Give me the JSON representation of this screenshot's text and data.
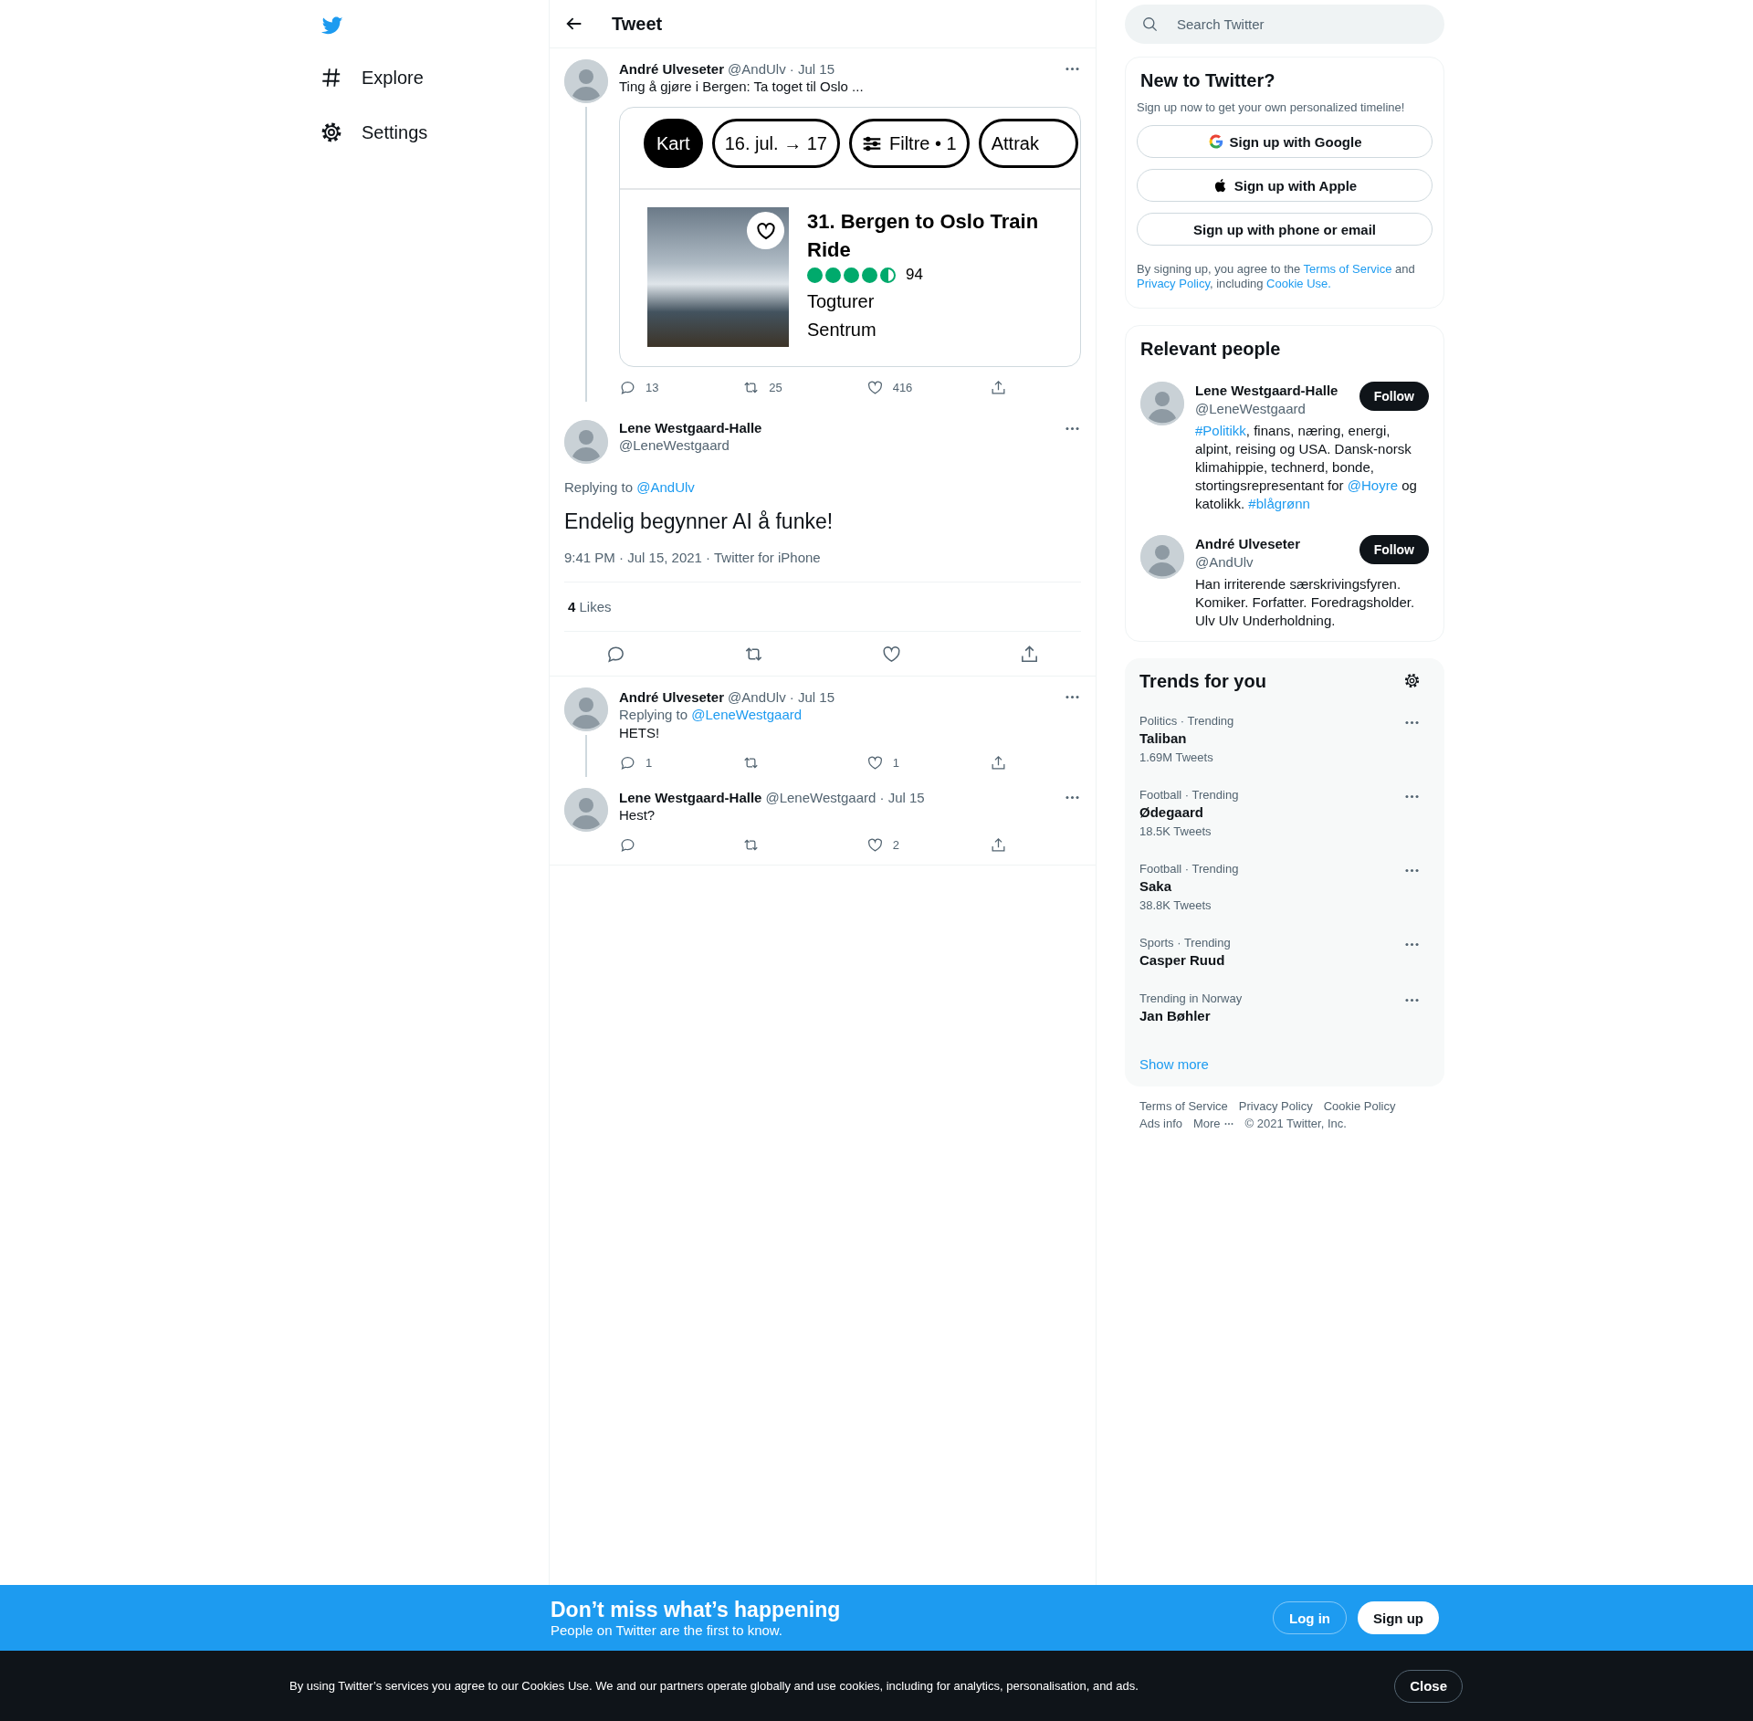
{
  "nav": {
    "items": [
      {
        "kind": "explore",
        "label": "Explore"
      },
      {
        "kind": "settings",
        "label": "Settings"
      }
    ]
  },
  "header": {
    "title": "Tweet"
  },
  "tweets": [
    {
      "kind": "thread",
      "name": "André Ulveseter",
      "meta": "@AndUlv · Jul 15",
      "text": "Ting å gjøre i Bergen: Ta toget til Oslo ...",
      "connected": true,
      "card": {
        "chips": [
          {
            "kind": "plain",
            "label": "Kart",
            "selected": true
          },
          {
            "kind": "plain",
            "label": "16. jul. → 17",
            "selected": false
          },
          {
            "kind": "filter",
            "label": "Filtre • 1",
            "selected": false
          },
          {
            "kind": "plain",
            "label": "Attrak",
            "selected": false
          }
        ],
        "result": {
          "title": "31. Bergen to Oslo Train Ride",
          "stars": 4.5,
          "count": "94",
          "lines": [
            "Togturer",
            "Sentrum"
          ]
        }
      },
      "actions": [
        {
          "kind": "reply",
          "count": "13"
        },
        {
          "kind": "retweet",
          "count": "25"
        },
        {
          "kind": "like",
          "count": "416"
        },
        {
          "kind": "share"
        }
      ]
    },
    {
      "kind": "focus",
      "name": "Lene Westgaard-Halle",
      "handle": "@LeneWestgaard",
      "replying_label": "Replying to",
      "replying_to": "@AndUlv",
      "text": "Endelig begynner AI å funke!",
      "meta": "9:41 PM · Jul 15, 2021 · Twitter for iPhone",
      "likes": {
        "count": "4",
        "label": "Likes"
      },
      "actions": [
        {
          "kind": "reply"
        },
        {
          "kind": "retweet"
        },
        {
          "kind": "like"
        },
        {
          "kind": "share"
        }
      ]
    },
    {
      "kind": "thread",
      "name": "André Ulveseter",
      "meta": "@AndUlv · Jul 15",
      "replying_label": "Replying to",
      "replying_to": "@LeneWestgaard",
      "text": "HETS!",
      "connected": true,
      "actions": [
        {
          "kind": "reply",
          "count": "1"
        },
        {
          "kind": "retweet"
        },
        {
          "kind": "like",
          "count": "1"
        },
        {
          "kind": "share"
        }
      ]
    },
    {
      "kind": "thread",
      "name": "Lene Westgaard-Halle",
      "meta": "@LeneWestgaard · Jul 15",
      "text": "Hest?",
      "connected": false,
      "actions": [
        {
          "kind": "reply"
        },
        {
          "kind": "retweet"
        },
        {
          "kind": "like",
          "count": "2"
        },
        {
          "kind": "share"
        }
      ]
    }
  ],
  "search": {
    "placeholder": "Search Twitter"
  },
  "signup": {
    "title": "New to Twitter?",
    "subtitle": "Sign up now to get your own personalized timeline!",
    "buttons": [
      {
        "kind": "google",
        "label": "Sign up with Google"
      },
      {
        "kind": "apple",
        "label": "Sign up with Apple"
      },
      {
        "kind": "plain",
        "label": "Sign up with phone or email"
      }
    ],
    "legal": [
      {
        "text": "By signing up, you agree to the "
      },
      {
        "text": "Terms of Service",
        "link": true
      },
      {
        "text": " and "
      },
      {
        "text": "Privacy Policy",
        "link": true
      },
      {
        "text": ", including "
      },
      {
        "text": "Cookie Use.",
        "link": true
      }
    ]
  },
  "relevant": {
    "title": "Relevant people",
    "people": [
      {
        "name": "Lene Westgaard-Halle",
        "handle": "@LeneWestgaard",
        "button": "Follow",
        "bio": [
          {
            "text": "#Politikk",
            "link": true
          },
          {
            "text": ", finans, næring, energi, alpint, reising og USA. Dansk-norsk klimahippie, technerd, bonde, stortingsrepresentant for "
          },
          {
            "text": "@Hoyre",
            "link": true
          },
          {
            "text": " og katolikk. "
          },
          {
            "text": "#blågrønn",
            "link": true
          }
        ]
      },
      {
        "name": "André Ulveseter",
        "handle": "@AndUlv",
        "button": "Follow",
        "bio": [
          {
            "text": "Han irriterende særskrivingsfyren. Komiker. Forfatter. Foredragsholder. Ulv Ulv Underholdning."
          }
        ]
      }
    ]
  },
  "trends": {
    "title": "Trends for you",
    "items": [
      {
        "context": "Politics · Trending",
        "name": "Taliban",
        "count": "1.69M Tweets"
      },
      {
        "context": "Football · Trending",
        "name": "Ødegaard",
        "count": "18.5K Tweets"
      },
      {
        "context": "Football · Trending",
        "name": "Saka",
        "count": "38.8K Tweets"
      },
      {
        "context": "Sports · Trending",
        "name": "Casper Ruud"
      },
      {
        "context": "Trending in Norway",
        "name": "Jan Bøhler"
      }
    ],
    "more": "Show more"
  },
  "footer": [
    [
      {
        "kind": "link",
        "text": "Terms of Service"
      },
      {
        "kind": "link",
        "text": "Privacy Policy"
      },
      {
        "kind": "link",
        "text": "Cookie Policy"
      }
    ],
    [
      {
        "kind": "link",
        "text": "Ads info"
      },
      {
        "kind": "more",
        "text": "More"
      },
      {
        "kind": "text",
        "text": "© 2021 Twitter, Inc."
      }
    ]
  ],
  "banner": {
    "title": "Don’t miss what’s happening",
    "subtitle": "People on Twitter are the first to know.",
    "buttons": [
      {
        "kind": "outline",
        "label": "Log in"
      },
      {
        "kind": "solid",
        "label": "Sign up"
      }
    ]
  },
  "cookie": {
    "text": "By using Twitter’s services you agree to our Cookies Use. We and our partners operate globally and use cookies, including for analytics, personalisation, and ads.",
    "button": "Close"
  }
}
